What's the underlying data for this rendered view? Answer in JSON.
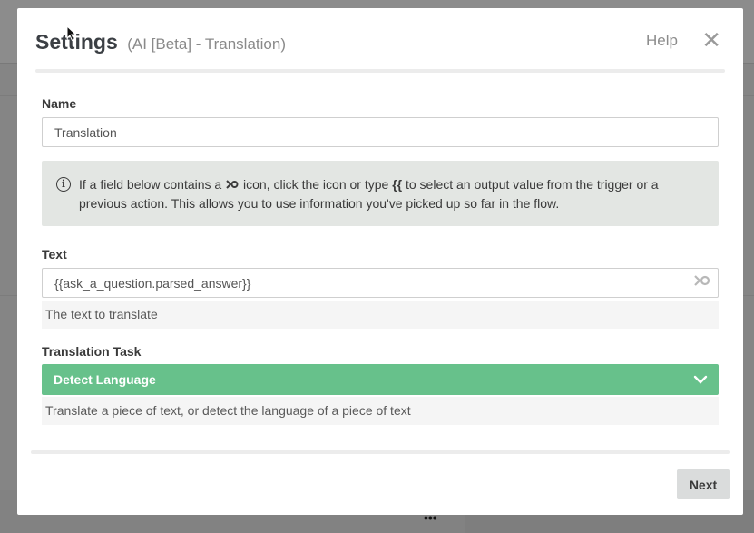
{
  "modal": {
    "title": "Settings",
    "subtitle": "(AI [Beta] - Translation)",
    "help_label": "Help",
    "close_glyph": "✕"
  },
  "name_field": {
    "label": "Name",
    "value": "Translation"
  },
  "info": {
    "text_part1": "If a field below contains a ",
    "icon_glyph": "⩾",
    "text_part2": " icon, click the icon or type ",
    "braces": "{{",
    "text_part3": " to select an output value from the trigger or a previous action. This allows you to use information you've picked up so far in the flow."
  },
  "text_field": {
    "label": "Text",
    "value": "{{ask_a_question.parsed_answer}}",
    "hint": "The text to translate",
    "map_icon": "mapping-icon"
  },
  "task_field": {
    "label": "Translation Task",
    "selected": "Detect Language",
    "hint": "Translate a piece of text, or detect the language of a piece of text"
  },
  "footer": {
    "next_label": "Next"
  },
  "background": {
    "dots": "•••"
  },
  "colors": {
    "accent_green": "#67c18b",
    "info_bg": "#e3e6e3",
    "button_bg": "#dadcdc"
  }
}
